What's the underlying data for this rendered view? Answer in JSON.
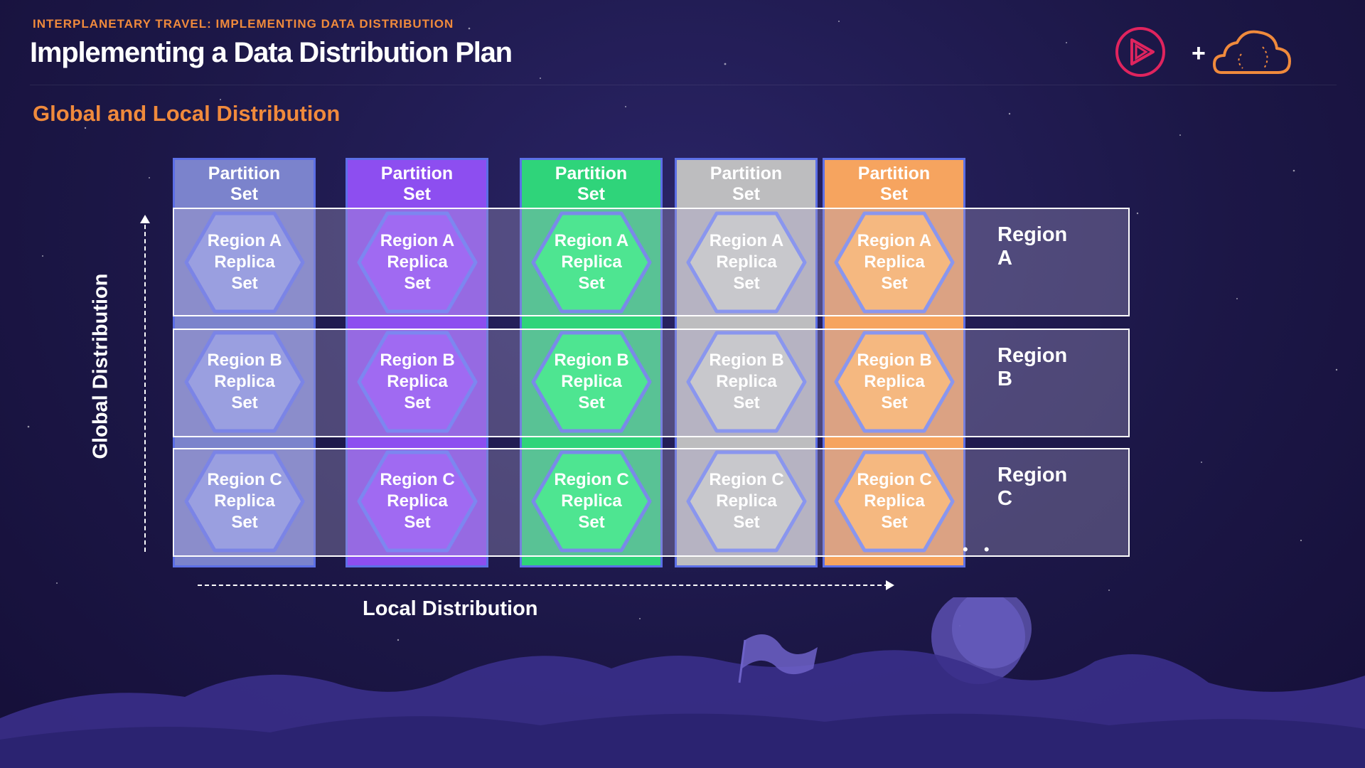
{
  "header": {
    "kicker": "INTERPLANETARY TRAVEL: IMPLEMENTING DATA DISTRIBUTION",
    "title": "Implementing a Data Distribution Plan",
    "subtitle": "Global and Local Distribution",
    "plus": "+",
    "logos": [
      "pluralsight-play-icon",
      "cloud-icon"
    ]
  },
  "diagram": {
    "columns": [
      {
        "header": "Partition\nSet",
        "color": "#7b83cc",
        "hex_fill": "#9a9fe0",
        "hex_stroke": "#7b84e6",
        "cells": [
          "Region A\nReplica\nSet",
          "Region B\nReplica\nSet",
          "Region C\nReplica\nSet"
        ]
      },
      {
        "header": "Partition\nSet",
        "color": "#8d4ef0",
        "hex_fill": "#a06af2",
        "hex_stroke": "#7d86f0",
        "cells": [
          "Region A\nReplica\nSet",
          "Region B\nReplica\nSet",
          "Region C\nReplica\nSet"
        ]
      },
      {
        "header": "Partition\nSet",
        "color": "#2fd47a",
        "hex_fill": "#4ee591",
        "hex_stroke": "#7a8ae8",
        "cells": [
          "Region A\nReplica\nSet",
          "Region B\nReplica\nSet",
          "Region C\nReplica\nSet"
        ]
      },
      {
        "header": "Partition\nSet",
        "color": "#bdbdbf",
        "hex_fill": "#c8c8cc",
        "hex_stroke": "#8a96ee",
        "cells": [
          "Region A\nReplica\nSet",
          "Region B\nReplica\nSet",
          "Region C\nReplica\nSet"
        ]
      },
      {
        "header": "Partition\nSet",
        "color": "#f6a45f",
        "hex_fill": "#f5b880",
        "hex_stroke": "#8a96ee",
        "cells": [
          "Region A\nReplica\nSet",
          "Region B\nReplica\nSet",
          "Region C\nReplica\nSet"
        ]
      }
    ],
    "regions": [
      "Region A",
      "Region B",
      "Region C"
    ],
    "axis_vertical_label": "Global Distribution",
    "axis_horizontal_label": "Local Distribution",
    "ellipsis": "• •"
  }
}
